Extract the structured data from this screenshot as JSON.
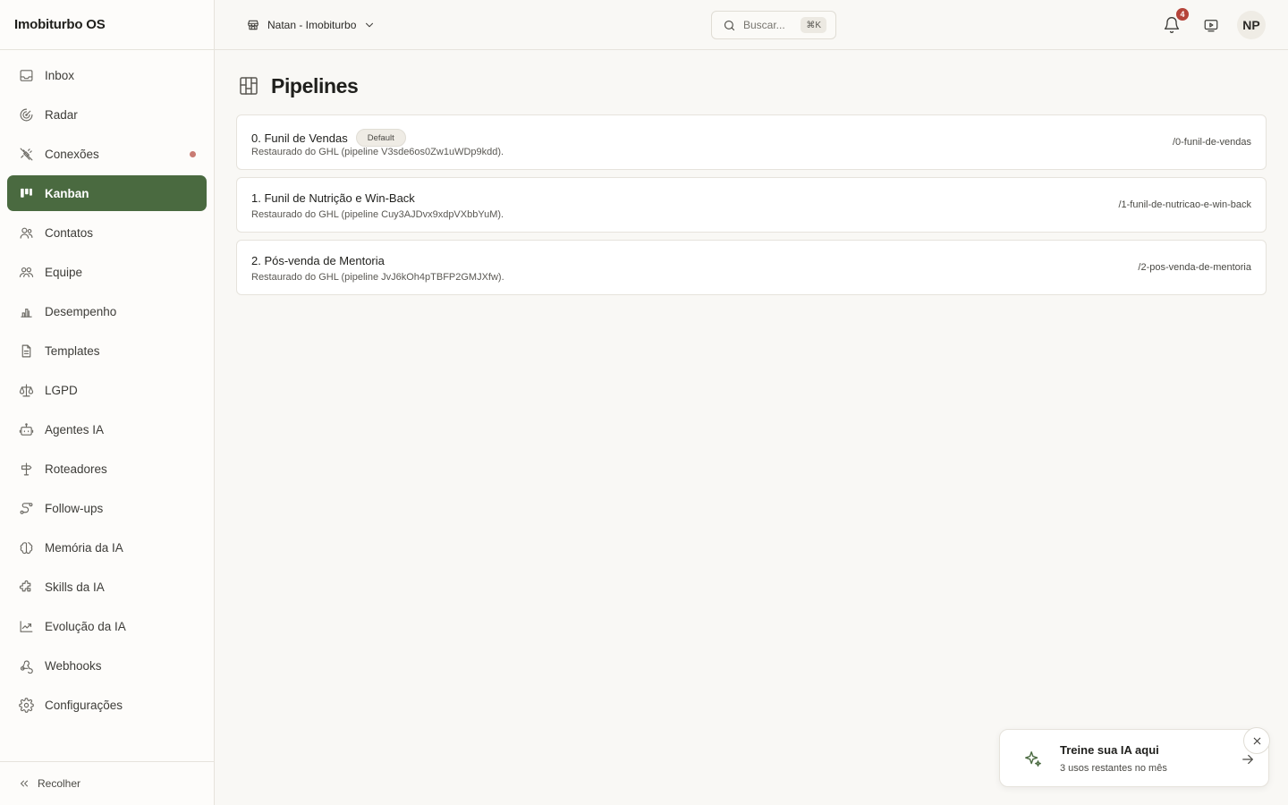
{
  "app": {
    "title": "Imobiturbo OS"
  },
  "sidebar": {
    "items": [
      {
        "label": "Inbox",
        "icon": "inbox-icon"
      },
      {
        "label": "Radar",
        "icon": "radar-icon"
      },
      {
        "label": "Conexões",
        "icon": "plug-off-icon",
        "has_dot": true
      },
      {
        "label": "Kanban",
        "icon": "kanban-icon",
        "active": true
      },
      {
        "label": "Contatos",
        "icon": "contacts-icon"
      },
      {
        "label": "Equipe",
        "icon": "team-icon"
      },
      {
        "label": "Desempenho",
        "icon": "bar-chart-icon"
      },
      {
        "label": "Templates",
        "icon": "file-text-icon"
      },
      {
        "label": "LGPD",
        "icon": "scale-icon"
      },
      {
        "label": "Agentes IA",
        "icon": "bot-icon"
      },
      {
        "label": "Roteadores",
        "icon": "signpost-icon"
      },
      {
        "label": "Follow-ups",
        "icon": "route-icon"
      },
      {
        "label": "Memória da IA",
        "icon": "brain-icon"
      },
      {
        "label": "Skills da IA",
        "icon": "puzzle-icon"
      },
      {
        "label": "Evolução da IA",
        "icon": "trending-up-icon"
      },
      {
        "label": "Webhooks",
        "icon": "webhook-icon"
      },
      {
        "label": "Configurações",
        "icon": "gear-icon"
      }
    ],
    "collapse_label": "Recolher"
  },
  "topbar": {
    "workspace": "Natan - Imobiturbo",
    "search_placeholder": "Buscar...",
    "search_shortcut": "⌘K",
    "notifications_count": "4",
    "avatar_initials": "NP"
  },
  "page": {
    "title": "Pipelines",
    "pipelines": [
      {
        "name": "0. Funil de Vendas",
        "badge": "Default",
        "description": "Restaurado do GHL (pipeline V3sde6os0Zw1uWDp9kdd).",
        "slug": "/0-funil-de-vendas"
      },
      {
        "name": "1. Funil de Nutrição e Win-Back",
        "badge": "",
        "description": "Restaurado do GHL (pipeline Cuy3AJDvx9xdpVXbbYuM).",
        "slug": "/1-funil-de-nutricao-e-win-back"
      },
      {
        "name": "2. Pós-venda de Mentoria",
        "badge": "",
        "description": "Restaurado do GHL (pipeline JvJ6kOh4pTBFP2GMJXfw).",
        "slug": "/2-pos-venda-de-mentoria"
      }
    ]
  },
  "toast": {
    "title": "Treine sua IA aqui",
    "subtitle": "3 usos restantes no mês"
  },
  "colors": {
    "accent": "#4a6a40",
    "background": "#f9f8f5",
    "badge": "#b5443a",
    "dot": "#c97b73"
  }
}
